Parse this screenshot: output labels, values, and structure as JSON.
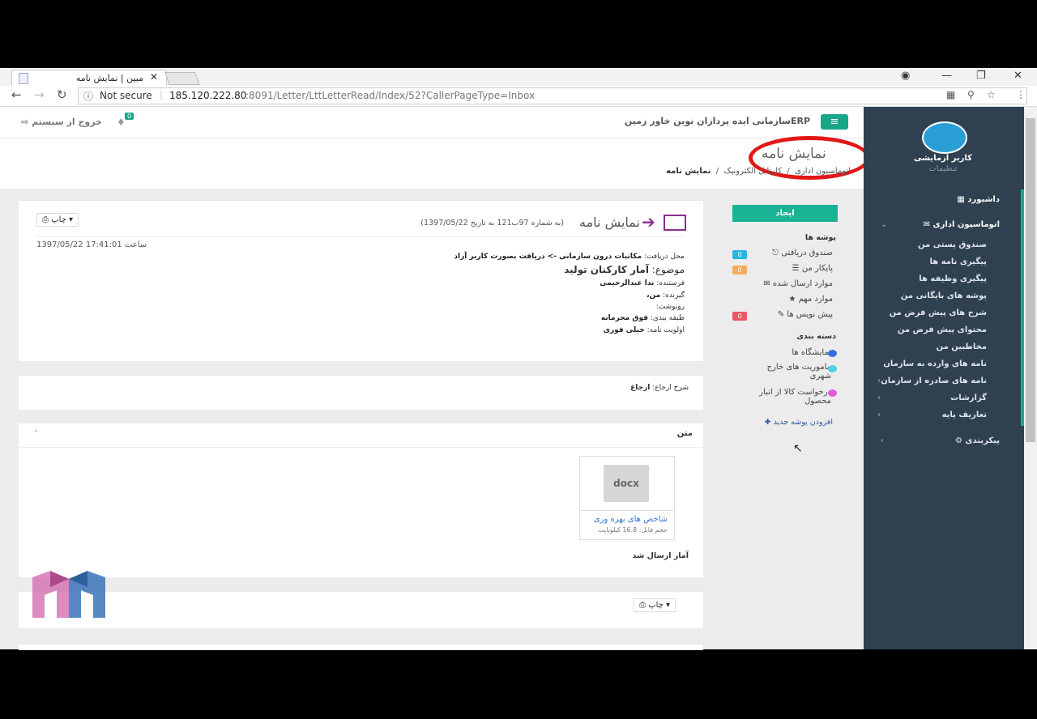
{
  "browser": {
    "tab_title": "مبین | نمایش نامه",
    "tab_close": "✕",
    "security_label": "Not secure",
    "url_host": "185.120.222.80",
    "url_path": ":8091/Letter/LttLetterRead/Index/52?CallerPageType=Inbox"
  },
  "topbar": {
    "app_title": "ERPسازمانی ایده پردازان نوین خاور زمین",
    "logout_label": "خروج از سیستم",
    "notification_count": "0"
  },
  "page": {
    "title": "نمایش نامه",
    "breadcrumb": [
      "اتوماسیون اداری",
      "کارتابل الکترونیک",
      "نمایش نامه"
    ]
  },
  "sidebar": {
    "user_name": "کاربر آزمایشی",
    "user_settings": "تنظیمات",
    "dashboard": "داشبورد",
    "office_automation": "اتوماسیون اداری",
    "items": [
      "صندوق پستی من",
      "پیگیری نامه ها",
      "پیگیری وظیفه ها",
      "پوشه های بایگانی من",
      "شرح های پیش فرض من",
      "محتوای پیش فرض من",
      "مخاطبین من",
      "نامه های وارده به سازمان",
      "نامه های صادره از سازمان",
      "گزارشات",
      "تعاریف پایه"
    ],
    "configuration": "پیکربندی"
  },
  "letter": {
    "title": "نمایش نامه",
    "subtitle": "(به شماره 97ب121 به تاریخ 1397/05/22)",
    "print_label": "چاپ",
    "date_time": "1397/05/22 ساعت 17:41:01",
    "receive_location_label": "محل دریافت:",
    "receive_location_value": "مکاتبات درون سازمانی -> دریافت بصورت کاربر آزاد",
    "subject_label": "موضوع:",
    "subject_value": "آمار کارکنان تولید",
    "sender_label": "فرستنده:",
    "sender_value": "ندا عبدالرحیمی",
    "receiver_label": "گیرنده:",
    "receiver_value": "من،",
    "cc_label": "رونوشت:",
    "classification_label": "طبقه بندی:",
    "classification_value": "فوق محرمانه",
    "priority_label": "اولویت نامه:",
    "priority_value": "خیلی فوری",
    "ref_label": "شرح ارجاع:",
    "ref_value": "ارجاع",
    "text_section_title": "متن",
    "file_type": "docx",
    "file_name": "شاخص های بهره وری",
    "file_size": "حجم فایل: 16.8 کیلوبایت",
    "body_text": "آمار ارسال شد"
  },
  "folders_panel": {
    "create_label": "ایجاد",
    "folders_header": "پوشه ها",
    "folders": [
      {
        "label": "صندوق دریافتی",
        "count": "0",
        "color": "#23b7e5"
      },
      {
        "label": "پایکار من",
        "count": "0",
        "color": "#f8ac59"
      },
      {
        "label": "موارد ارسال شده",
        "count": "",
        "color": ""
      },
      {
        "label": "موارد مهم",
        "count": "",
        "color": ""
      },
      {
        "label": "پیش نویس ها",
        "count": "0",
        "color": "#ed5565"
      }
    ],
    "categories_header": "دسته بندی",
    "categories": [
      {
        "label": "نمایشگاه ها",
        "color": "#2f6fde"
      },
      {
        "label": "ماموریت های خارج شهری",
        "color": "#4dd3e8"
      },
      {
        "label": "درخواست کالا از انبار محصول",
        "color": "#e85ad8"
      }
    ],
    "add_folder_label": "افزودن پوشه جدید"
  },
  "colors": {
    "accent": "#1ab394",
    "sidebar_bg": "#2f4050",
    "highlight_ring": "#e21818",
    "letter_icon": "#8e2d8e"
  }
}
